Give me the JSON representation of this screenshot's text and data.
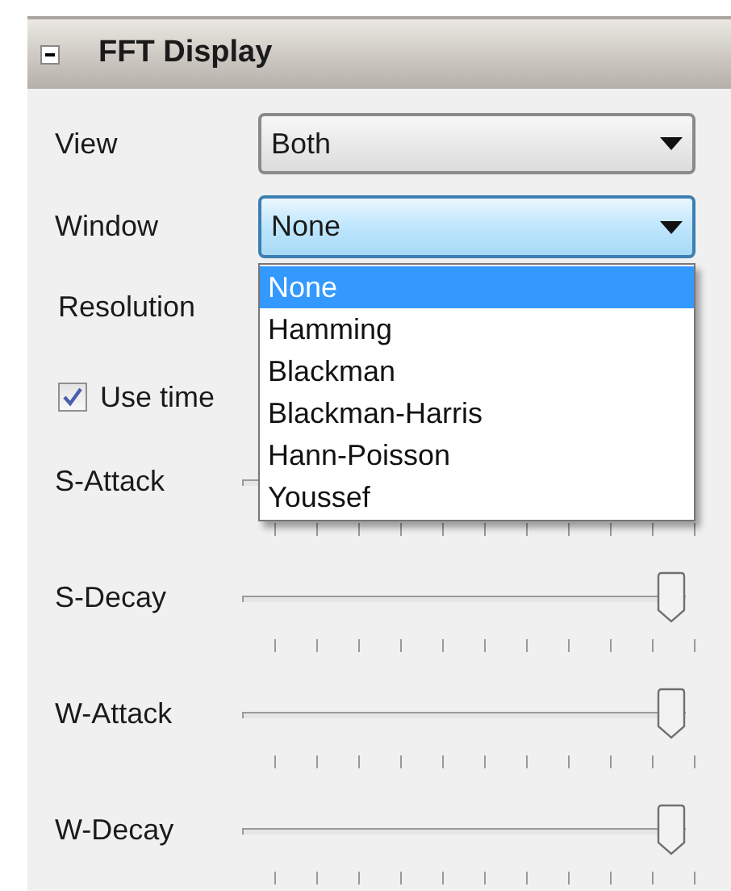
{
  "panel": {
    "title": "FFT Display",
    "expanded": true
  },
  "view": {
    "label": "View",
    "value": "Both"
  },
  "window": {
    "label": "Window",
    "value": "None",
    "expanded": true,
    "options": [
      {
        "label": "None",
        "selected": true
      },
      {
        "label": "Hamming",
        "selected": false
      },
      {
        "label": "Blackman",
        "selected": false
      },
      {
        "label": "Blackman-Harris",
        "selected": false
      },
      {
        "label": "Hann-Poisson",
        "selected": false
      },
      {
        "label": "Youssef",
        "selected": false
      }
    ]
  },
  "resolution": {
    "label": "Resolution"
  },
  "use_time": {
    "label": "Use time",
    "checked": true
  },
  "sliders": [
    {
      "label": "S-Attack"
    },
    {
      "label": "S-Decay",
      "level": 1
    },
    {
      "label": "W-Attack",
      "level": 1
    },
    {
      "label": "W-Decay",
      "level": 1
    }
  ]
}
